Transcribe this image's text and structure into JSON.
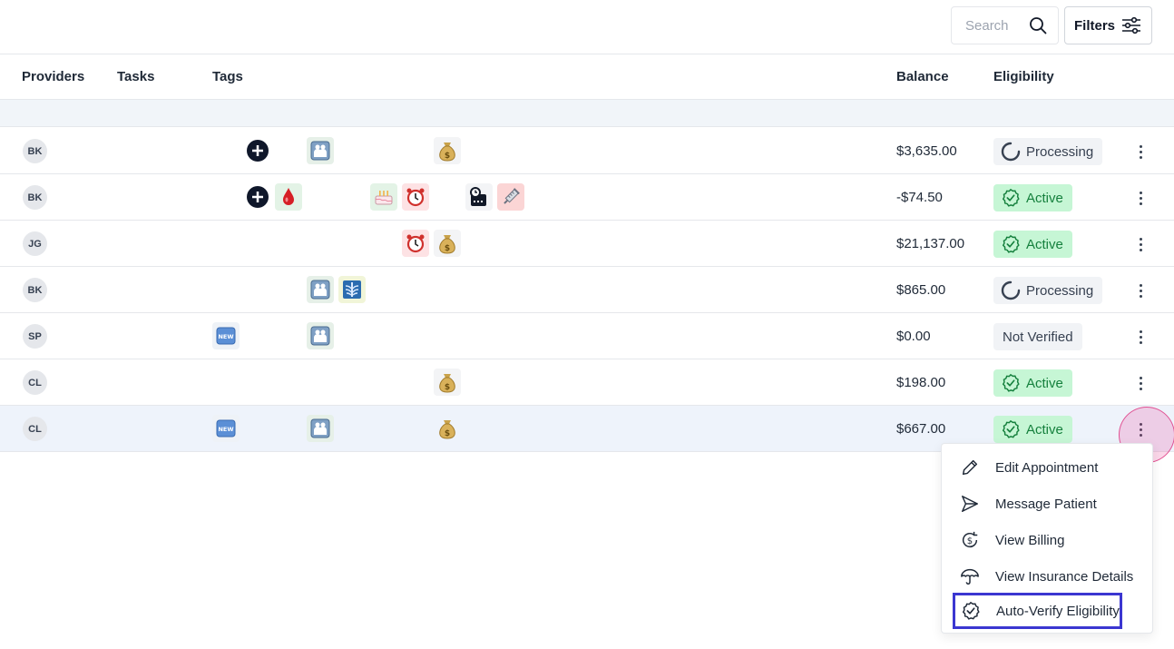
{
  "toolbar": {
    "search_placeholder": "Search",
    "filters_label": "Filters"
  },
  "table": {
    "headers": {
      "providers": "Providers",
      "tasks": "Tasks",
      "tags": "Tags",
      "balance": "Balance",
      "eligibility": "Eligibility"
    },
    "rows": [
      {
        "provider": "BK",
        "balance": "$3,635.00",
        "eligibility": "Processing",
        "tags": [
          "plus-circle-icon",
          "family-icon",
          "money-bag-icon"
        ]
      },
      {
        "provider": "BK",
        "balance": "-$74.50",
        "eligibility": "Active",
        "tags": [
          "plus-circle-icon",
          "blood-drop-icon",
          "birthday-cake-icon",
          "alarm-clock-icon",
          "calendar-clock-icon",
          "syringe-icon"
        ]
      },
      {
        "provider": "JG",
        "balance": "$21,137.00",
        "eligibility": "Active",
        "tags": [
          "alarm-clock-icon",
          "money-bag-icon"
        ]
      },
      {
        "provider": "BK",
        "balance": "$865.00",
        "eligibility": "Processing",
        "tags": [
          "family-icon",
          "xray-icon"
        ]
      },
      {
        "provider": "SP",
        "balance": "$0.00",
        "eligibility": "Not Verified",
        "tags": [
          "new-badge-icon",
          "family-icon"
        ]
      },
      {
        "provider": "CL",
        "balance": "$198.00",
        "eligibility": "Active",
        "tags": [
          "money-bag-icon"
        ]
      },
      {
        "provider": "CL",
        "balance": "$667.00",
        "eligibility": "Active",
        "tags": [
          "new-badge-icon",
          "family-icon",
          "money-bag-icon"
        ]
      }
    ]
  },
  "context_menu": {
    "items": [
      {
        "label": "Edit Appointment",
        "icon": "pencil-icon"
      },
      {
        "label": "Message Patient",
        "icon": "send-icon"
      },
      {
        "label": "View Billing",
        "icon": "billing-icon"
      },
      {
        "label": "View Insurance Details",
        "icon": "umbrella-icon"
      },
      {
        "label": "Auto-Verify Eligibility",
        "icon": "badge-check-icon"
      }
    ]
  },
  "colors": {
    "active_bg": "#c6f6d5",
    "active_text": "#15803d",
    "processing_bg": "#f1f3f6",
    "highlight_border": "#3b36d1",
    "click_marker": "#ec4899"
  }
}
